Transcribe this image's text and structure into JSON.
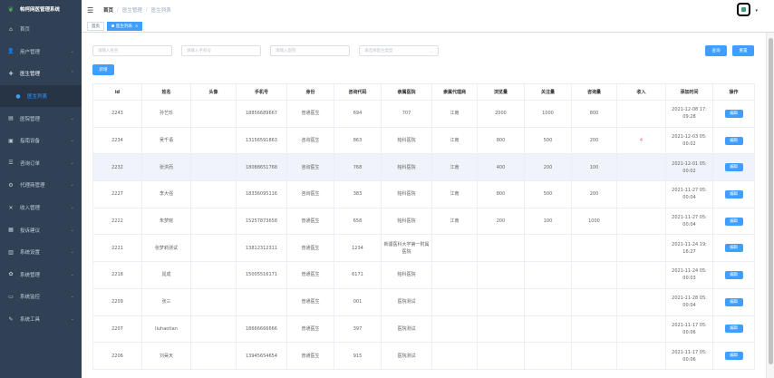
{
  "app": {
    "title": "帕柯网医管理系统"
  },
  "sidebar": {
    "items": [
      {
        "label": "首页",
        "icon": "home-icon",
        "glyph": "⌂"
      },
      {
        "label": "用户管理",
        "icon": "user-icon",
        "glyph": "👤"
      },
      {
        "label": "医生管理",
        "icon": "doctor-icon",
        "glyph": "✚"
      },
      {
        "label": "医生列表",
        "icon": "person-icon",
        "glyph": "●"
      },
      {
        "label": "医院管理",
        "icon": "hospital-icon",
        "glyph": "▤"
      },
      {
        "label": "指南设备",
        "icon": "device-icon",
        "glyph": "▣"
      },
      {
        "label": "咨询订单",
        "icon": "order-icon",
        "glyph": "☰"
      },
      {
        "label": "代理商管理",
        "icon": "agent-icon",
        "glyph": "⚙"
      },
      {
        "label": "收入管理",
        "icon": "income-icon",
        "glyph": "✕"
      },
      {
        "label": "投诉建议",
        "icon": "complaint-icon",
        "glyph": "▦"
      },
      {
        "label": "系统设置",
        "icon": "settings-icon",
        "glyph": "▥"
      },
      {
        "label": "系统管理",
        "icon": "gear-icon",
        "glyph": "✿"
      },
      {
        "label": "系统监控",
        "icon": "monitor-icon",
        "glyph": "▭"
      },
      {
        "label": "系统工具",
        "icon": "tool-icon",
        "glyph": "✎"
      }
    ]
  },
  "header": {
    "breadcrumb": [
      "首页",
      "医生管理",
      "医生列表"
    ]
  },
  "tags": [
    {
      "label": "首页"
    },
    {
      "label": "医生列表"
    }
  ],
  "filters": {
    "name_placeholder": "请输入姓名",
    "phone_placeholder": "请输入手机号",
    "hospital_placeholder": "请输入医院",
    "type_placeholder": "请选择医生类型"
  },
  "buttons": {
    "search": "查询",
    "reset": "重置",
    "add": "新增",
    "edit": "编辑"
  },
  "table": {
    "columns": [
      "id",
      "姓名",
      "头像",
      "手机号",
      "身份",
      "咨询代码",
      "隶属医院",
      "隶属代理商",
      "浏览量",
      "关注量",
      "咨询量",
      "收入",
      "添加时间",
      "操作"
    ],
    "rows": [
      {
        "id": "2243",
        "name": "孙艺珍",
        "phone": "18856689667",
        "role": "普通医生",
        "code": "694",
        "hospital": "707",
        "agent": "江南",
        "views": "2000",
        "follows": "1000",
        "consults": "800",
        "income": "",
        "time1": "2021-12-08 17:",
        "time2": "09:28"
      },
      {
        "id": "2234",
        "name": "吴千语",
        "phone": "13156591863",
        "role": "咨询医生",
        "code": "863",
        "hospital": "帕科医院",
        "agent": "江南",
        "views": "800",
        "follows": "500",
        "consults": "200",
        "income": "4",
        "time1": "2021-12-03 05:",
        "time2": "00:02"
      },
      {
        "id": "2232",
        "name": "张洪而",
        "phone": "18088651768",
        "role": "咨询医生",
        "code": "768",
        "hospital": "帕科医院",
        "agent": "江南",
        "views": "400",
        "follows": "200",
        "consults": "100",
        "income": "",
        "time1": "2021-12-01 05:",
        "time2": "00:02"
      },
      {
        "id": "2227",
        "name": "李大强",
        "phone": "18336095116",
        "role": "咨询医生",
        "code": "383",
        "hospital": "帕科医院",
        "agent": "江南",
        "views": "800",
        "follows": "500",
        "consults": "200",
        "income": "",
        "time1": "2021-11-27 05:",
        "time2": "00:04"
      },
      {
        "id": "2222",
        "name": "朱梦晓",
        "phone": "15257873658",
        "role": "普通医生",
        "code": "658",
        "hospital": "帕科医院",
        "agent": "江南",
        "views": "200",
        "follows": "100",
        "consults": "1000",
        "income": "",
        "time1": "2021-11-27 05:",
        "time2": "00:04"
      },
      {
        "id": "2221",
        "name": "张梦莉测试",
        "phone": "13812312311",
        "role": "普通医生",
        "code": "1234",
        "hospital": "新疆医科大学第一附属医院",
        "agent": "",
        "views": "",
        "follows": "",
        "consults": "",
        "income": "",
        "time1": "2021-11-24 19:",
        "time2": "16:27"
      },
      {
        "id": "2218",
        "name": "晁成",
        "phone": "15005516171",
        "role": "普通医生",
        "code": "6171",
        "hospital": "帕科医院",
        "agent": "",
        "views": "",
        "follows": "",
        "consults": "",
        "income": "",
        "time1": "2021-11-24 05:",
        "time2": "00:03"
      },
      {
        "id": "2209",
        "name": "张三",
        "phone": "",
        "role": "普通医生",
        "code": "001",
        "hospital": "医院测试",
        "agent": "",
        "views": "",
        "follows": "",
        "consults": "",
        "income": "",
        "time1": "2021-11-28 05:",
        "time2": "00:04"
      },
      {
        "id": "2207",
        "name": "liuhaotian",
        "phone": "18666666666",
        "role": "普通医生",
        "code": "397",
        "hospital": "医院测试",
        "agent": "",
        "views": "",
        "follows": "",
        "consults": "",
        "income": "",
        "time1": "2021-11-17 05:",
        "time2": "00:06"
      },
      {
        "id": "2206",
        "name": "刘昊天",
        "phone": "13945654654",
        "role": "普通医生",
        "code": "915",
        "hospital": "医院测试",
        "agent": "",
        "views": "",
        "follows": "",
        "consults": "",
        "income": "",
        "time1": "2021-11-17 05:",
        "time2": "00:06"
      }
    ]
  },
  "colors": {
    "sidebar": "#304156",
    "primary": "#409eff",
    "danger": "#f56c6c"
  }
}
